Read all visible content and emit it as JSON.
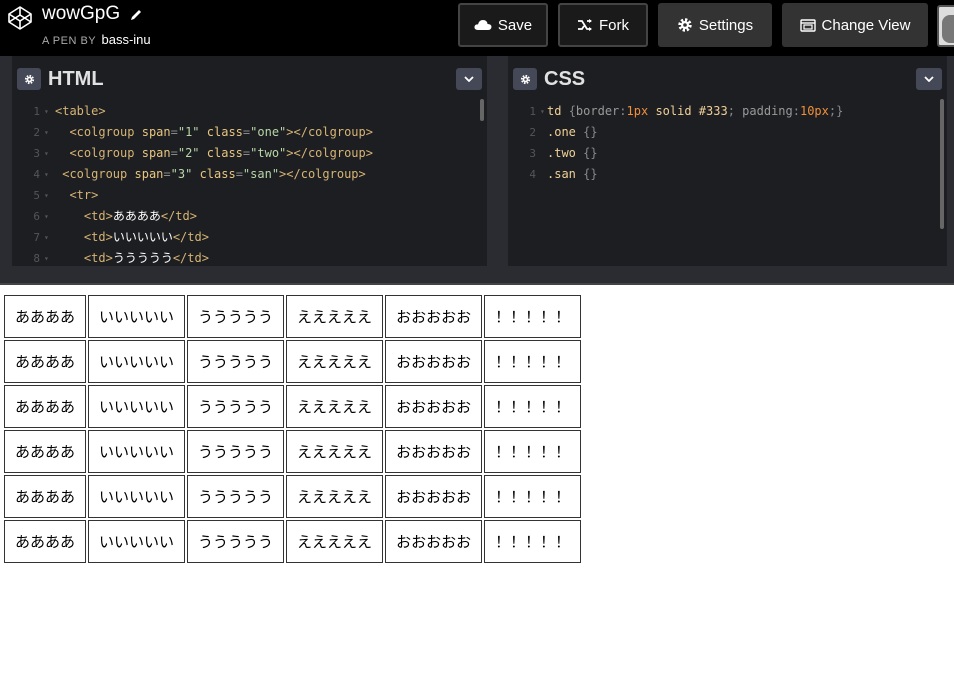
{
  "header": {
    "title": "wowGpG",
    "byline_prefix": "A PEN BY",
    "author": "bass-inu",
    "buttons": {
      "save": "Save",
      "fork": "Fork",
      "settings": "Settings",
      "change_view": "Change View"
    }
  },
  "html_panel": {
    "title": "HTML",
    "lines": [
      {
        "n": "1",
        "html": "<span class='t-tag'>&lt;table&gt;</span>"
      },
      {
        "n": "2",
        "html": "  <span class='t-tag'>&lt;colgroup</span> <span class='t-attr'>span</span><span class='t-punc'>=</span><span class='t-str'>\"1\"</span> <span class='t-attr'>class</span><span class='t-punc'>=</span><span class='t-str'>\"one\"</span><span class='t-tag'>&gt;&lt;/colgroup&gt;</span>"
      },
      {
        "n": "3",
        "html": "  <span class='t-tag'>&lt;colgroup</span> <span class='t-attr'>span</span><span class='t-punc'>=</span><span class='t-str'>\"2\"</span> <span class='t-attr'>class</span><span class='t-punc'>=</span><span class='t-str'>\"two\"</span><span class='t-tag'>&gt;&lt;/colgroup&gt;</span>"
      },
      {
        "n": "4",
        "html": " <span class='t-tag'>&lt;colgroup</span> <span class='t-attr'>span</span><span class='t-punc'>=</span><span class='t-str'>\"3\"</span> <span class='t-attr'>class</span><span class='t-punc'>=</span><span class='t-str'>\"san\"</span><span class='t-tag'>&gt;&lt;/colgroup&gt;</span>"
      },
      {
        "n": "5",
        "html": "  <span class='t-tag'>&lt;tr&gt;</span>"
      },
      {
        "n": "6",
        "html": "    <span class='t-tag'>&lt;td&gt;</span><span class='t-txt'>ああああ</span><span class='t-tag'>&lt;/td&gt;</span>"
      },
      {
        "n": "7",
        "html": "    <span class='t-tag'>&lt;td&gt;</span><span class='t-txt'>いいいいい</span><span class='t-tag'>&lt;/td&gt;</span>"
      },
      {
        "n": "8",
        "html": "    <span class='t-tag'>&lt;td&gt;</span><span class='t-txt'>ううううう</span><span class='t-tag'>&lt;/td&gt;</span>"
      }
    ]
  },
  "css_panel": {
    "title": "CSS",
    "lines": [
      {
        "n": "1",
        "html": "<span class='t-sel'>td</span> <span class='t-punc'>{</span><span class='t-prop'>border</span><span class='t-punc'>:</span><span class='t-num'>1px</span> <span class='t-sel'>solid</span> <span class='t-sel'>#333</span><span class='t-punc'>;</span> <span class='t-prop'>padding</span><span class='t-punc'>:</span><span class='t-num'>10px</span><span class='t-punc'>;}</span>"
      },
      {
        "n": "2",
        "html": "<span class='t-sel'>.one</span> <span class='t-punc'>{}</span>"
      },
      {
        "n": "3",
        "html": "<span class='t-sel'>.two</span> <span class='t-punc'>{}</span>"
      },
      {
        "n": "4",
        "html": "<span class='t-sel'>.san</span> <span class='t-punc'>{}</span>"
      }
    ]
  },
  "result_table": {
    "row_cells": [
      "ああああ",
      "いいいいい",
      "ううううう",
      "えええええ",
      "おおおおお",
      "！！！！！"
    ],
    "rows": 6
  }
}
